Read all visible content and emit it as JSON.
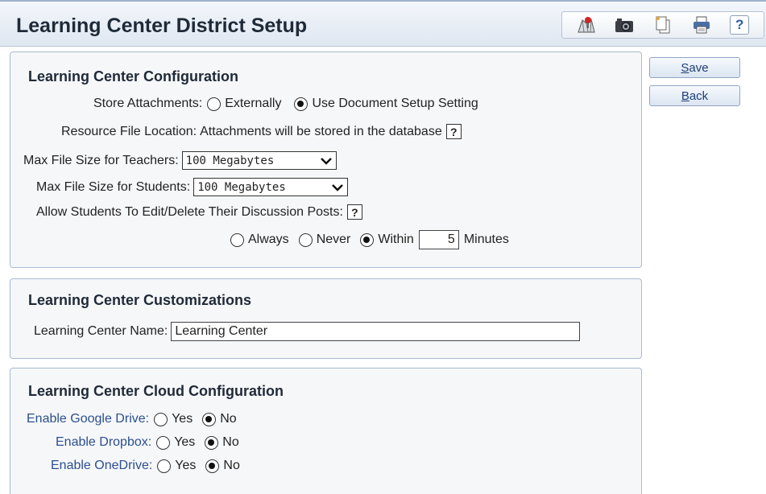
{
  "header": {
    "title": "Learning Center District Setup",
    "icons": [
      "map-pin-icon",
      "camera-icon",
      "copy-icon",
      "print-icon",
      "help-icon"
    ],
    "help_label": "?"
  },
  "buttons": {
    "save_first": "S",
    "save_rest": "ave",
    "back_first": "B",
    "back_rest": "ack"
  },
  "config": {
    "title": "Learning Center Configuration",
    "store_label": "Store Attachments:",
    "opt_external": "Externally",
    "opt_document": "Use Document Setup Setting",
    "store_selected": "Use Document Setup Setting",
    "resource_label": "Resource File Location:",
    "resource_value": "Attachments will be stored in the database",
    "help": "?",
    "max_teachers_label": "Max File Size for Teachers:",
    "max_teachers_value": "100 Megabytes",
    "max_students_label": "Max File Size for Students:",
    "max_students_value": "100 Megabytes",
    "allow_edit_label": "Allow Students To Edit/Delete Their Discussion Posts:",
    "opt_always": "Always",
    "opt_never": "Never",
    "opt_within": "Within",
    "allow_selected": "Within",
    "within_value": "5",
    "minutes_label": "Minutes"
  },
  "custom": {
    "title": "Learning Center Customizations",
    "name_label": "Learning Center Name:",
    "name_value": "Learning Center"
  },
  "cloud": {
    "title": "Learning Center Cloud Configuration",
    "google_label": "Enable Google Drive:",
    "dropbox_label": "Enable Dropbox:",
    "onedrive_label": "Enable OneDrive:",
    "yes": "Yes",
    "no": "No",
    "google_selected": "No",
    "dropbox_selected": "No",
    "onedrive_selected": "No"
  }
}
